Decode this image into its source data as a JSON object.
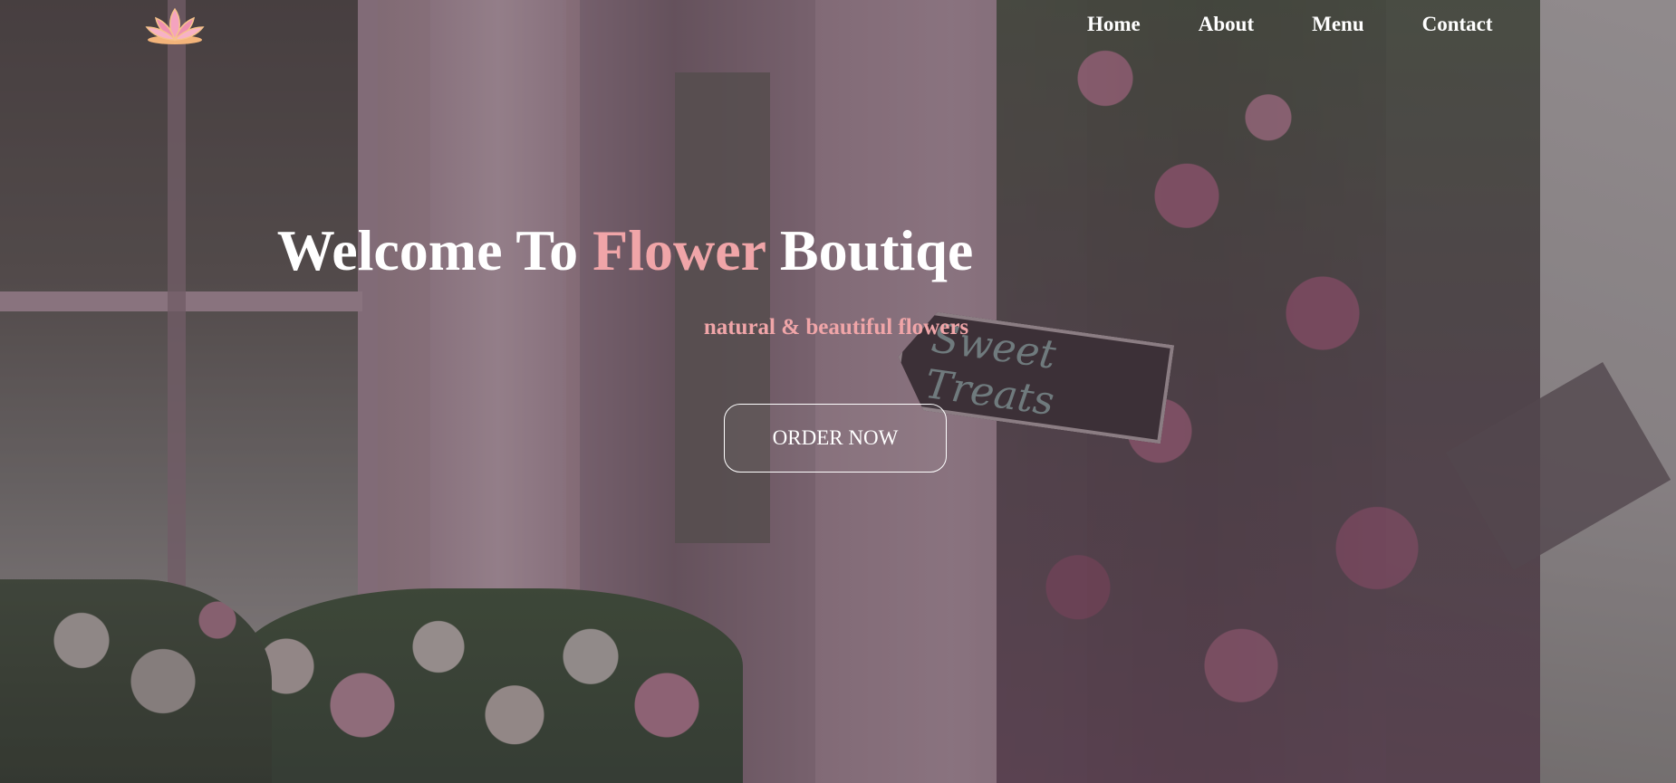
{
  "nav": {
    "logo_icon": "lotus-icon",
    "items": [
      {
        "label": "Home"
      },
      {
        "label": "About"
      },
      {
        "label": "Menu"
      },
      {
        "label": "Contact"
      }
    ]
  },
  "hero": {
    "title_prefix": "Welcome To ",
    "title_accent": "Flower",
    "title_suffix": " Boutiqe",
    "subtitle": "natural & beautiful flowers",
    "cta_label": "ORDER NOW",
    "background_sign_text": "Sweet Treats"
  },
  "colors": {
    "accent": "#f0a5a8",
    "text": "#ffffff"
  }
}
